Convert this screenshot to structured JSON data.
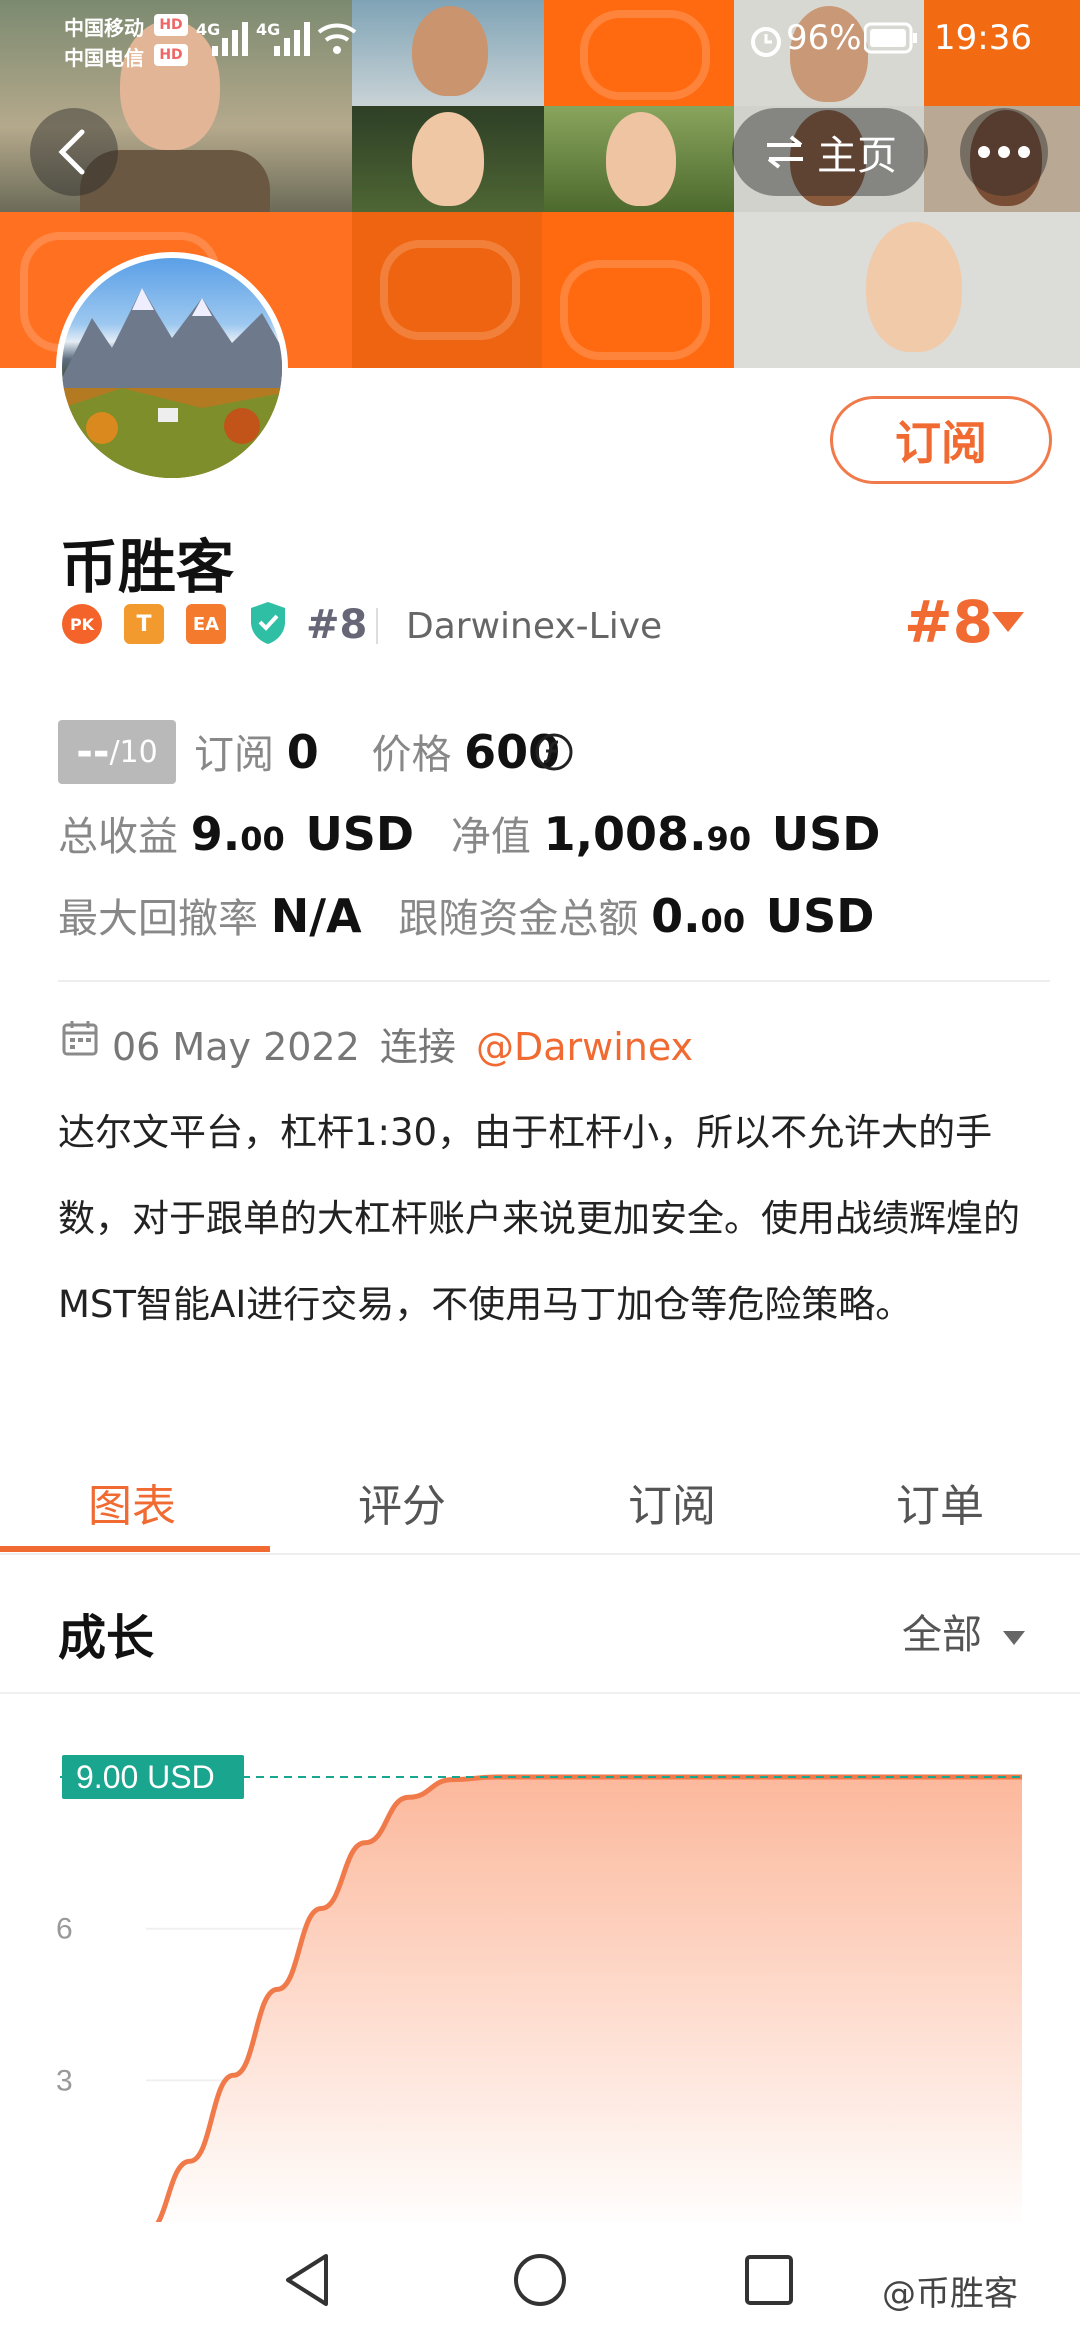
{
  "status_bar": {
    "carrier1": "中国移动",
    "carrier2": "中国电信",
    "hd": "HD",
    "net": "4G",
    "battery": "96%",
    "time": "19:36"
  },
  "nav": {
    "home_label": "主页"
  },
  "profile": {
    "name": "币胜客",
    "subscribe_label": "订阅",
    "badges": [
      "PK",
      "T",
      "EA"
    ],
    "rank_small": "#8",
    "broker": "Darwinex-Live",
    "rank_big": "#8",
    "score": "--",
    "score_max": "/10",
    "subscribe_count_label": "订阅",
    "subscribe_count": "0",
    "price_label": "价格",
    "price": "600"
  },
  "stats": {
    "total_profit_label": "总收益",
    "total_profit_int": "9.",
    "total_profit_dec": "00",
    "total_profit_unit": "USD",
    "equity_label": "净值",
    "equity_int": "1,008.",
    "equity_dec": "90",
    "equity_unit": "USD",
    "drawdown_label": "最大回撤率",
    "drawdown": "N/A",
    "follow_label": "跟随资金总额",
    "follow_int": "0.",
    "follow_dec": "00",
    "follow_unit": "USD"
  },
  "account": {
    "date": "06 May 2022",
    "connect_label": "连接",
    "link": "@Darwinex",
    "description": "达尔文平台，杠杆1:30，由于杠杆小，所以不允许大的手数，对于跟单的大杠杆账户来说更加安全。使用战绩辉煌的MST智能AI进行交易，不使用马丁加仓等危险策略。"
  },
  "tabs": [
    "图表",
    "评分",
    "订阅",
    "订单"
  ],
  "section": {
    "title": "成长",
    "filter": "全部"
  },
  "chart_data": {
    "type": "area",
    "title": "",
    "ylabel": "",
    "xlabel": "",
    "y_ticks": [
      3,
      6
    ],
    "current_label": "9.00 USD",
    "current_value": 9.0,
    "ylim": [
      0,
      9.5
    ],
    "x": [
      0,
      0.05,
      0.1,
      0.15,
      0.2,
      0.25,
      0.3,
      0.35,
      0.4,
      0.5,
      0.6,
      0.8,
      1.0
    ],
    "values": [
      0.0,
      1.4,
      3.1,
      4.8,
      6.4,
      7.7,
      8.6,
      8.95,
      9.0,
      9.0,
      9.0,
      9.0,
      9.0
    ],
    "colors": {
      "line": "#f07a4a",
      "fill_top": "#fcb89c",
      "fill_bottom": "#ffffff",
      "label_bg": "#1aa58f"
    }
  },
  "watermark": "@币胜客",
  "colors": {
    "accent": "#f06a32",
    "header": "#ff6a10"
  }
}
